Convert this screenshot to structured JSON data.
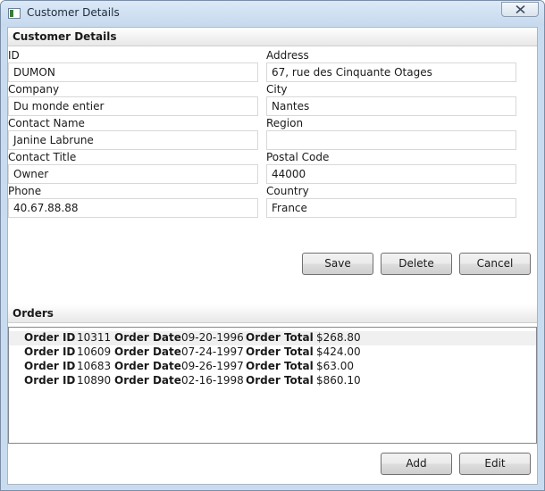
{
  "window": {
    "title": "Customer Details"
  },
  "customer": {
    "header": "Customer Details",
    "fields": {
      "id": {
        "label": "ID",
        "value": "DUMON"
      },
      "company": {
        "label": "Company",
        "value": "Du monde entier"
      },
      "contact_name": {
        "label": "Contact Name",
        "value": "Janine Labrune"
      },
      "contact_title": {
        "label": "Contact Title",
        "value": "Owner"
      },
      "phone": {
        "label": "Phone",
        "value": "40.67.88.88"
      },
      "address": {
        "label": "Address",
        "value": "67, rue des Cinquante Otages"
      },
      "city": {
        "label": "City",
        "value": "Nantes"
      },
      "region": {
        "label": "Region",
        "value": ""
      },
      "postal_code": {
        "label": "Postal Code",
        "value": "44000"
      },
      "country": {
        "label": "Country",
        "value": "France"
      }
    },
    "buttons": {
      "save": "Save",
      "delete": "Delete",
      "cancel": "Cancel"
    }
  },
  "orders": {
    "header": "Orders",
    "labels": {
      "order_id": "Order ID",
      "order_date": "Order Date",
      "order_total": "Order Total"
    },
    "rows": [
      {
        "id": "10311",
        "date": "09-20-1996",
        "total": "$268.80"
      },
      {
        "id": "10609",
        "date": "07-24-1997",
        "total": "$424.00"
      },
      {
        "id": "10683",
        "date": "09-26-1997",
        "total": "$63.00"
      },
      {
        "id": "10890",
        "date": "02-16-1998",
        "total": "$860.10"
      }
    ],
    "buttons": {
      "add": "Add",
      "edit": "Edit"
    }
  }
}
